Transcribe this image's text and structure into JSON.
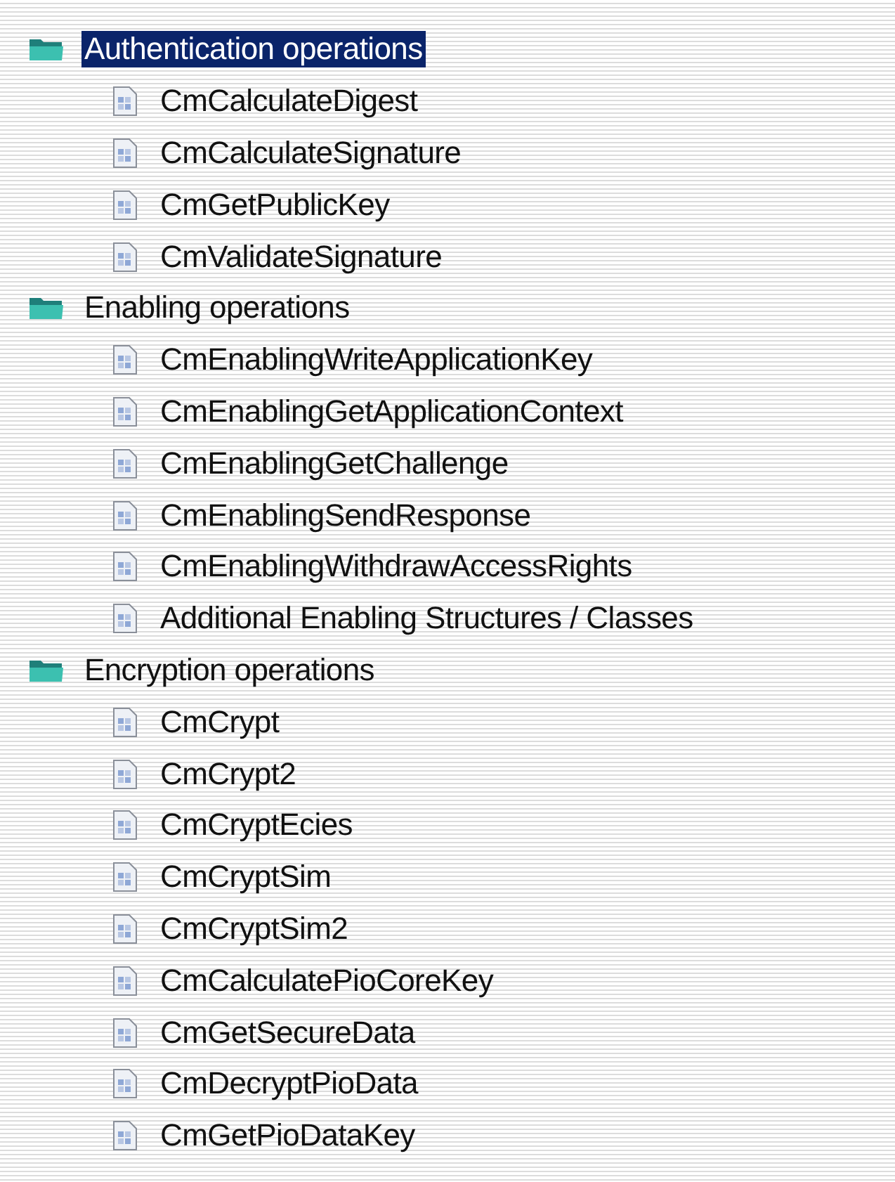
{
  "tree": [
    {
      "label": "Authentication operations",
      "selected": true,
      "expanded": true,
      "children": [
        {
          "label": "CmCalculateDigest",
          "selected": false
        },
        {
          "label": "CmCalculateSignature",
          "selected": false
        },
        {
          "label": "CmGetPublicKey",
          "selected": false
        },
        {
          "label": "CmValidateSignature",
          "selected": false
        }
      ]
    },
    {
      "label": "Enabling operations",
      "selected": false,
      "expanded": true,
      "children": [
        {
          "label": "CmEnablingWriteApplicationKey",
          "selected": false
        },
        {
          "label": "CmEnablingGetApplicationContext",
          "selected": false
        },
        {
          "label": "CmEnablingGetChallenge",
          "selected": false
        },
        {
          "label": "CmEnablingSendResponse",
          "selected": false
        },
        {
          "label": "CmEnablingWithdrawAccessRights",
          "selected": false
        },
        {
          "label": "Additional Enabling Structures / Classes",
          "selected": false
        }
      ]
    },
    {
      "label": "Encryption operations",
      "selected": false,
      "expanded": true,
      "children": [
        {
          "label": "CmCrypt",
          "selected": false
        },
        {
          "label": "CmCrypt2",
          "selected": false
        },
        {
          "label": "CmCryptEcies",
          "selected": false
        },
        {
          "label": "CmCryptSim",
          "selected": false
        },
        {
          "label": "CmCryptSim2",
          "selected": false
        },
        {
          "label": "CmCalculatePioCoreKey",
          "selected": false
        },
        {
          "label": "CmGetSecureData",
          "selected": false
        },
        {
          "label": "CmDecryptPioData",
          "selected": false
        },
        {
          "label": "CmGetPioDataKey",
          "selected": false
        }
      ]
    }
  ]
}
